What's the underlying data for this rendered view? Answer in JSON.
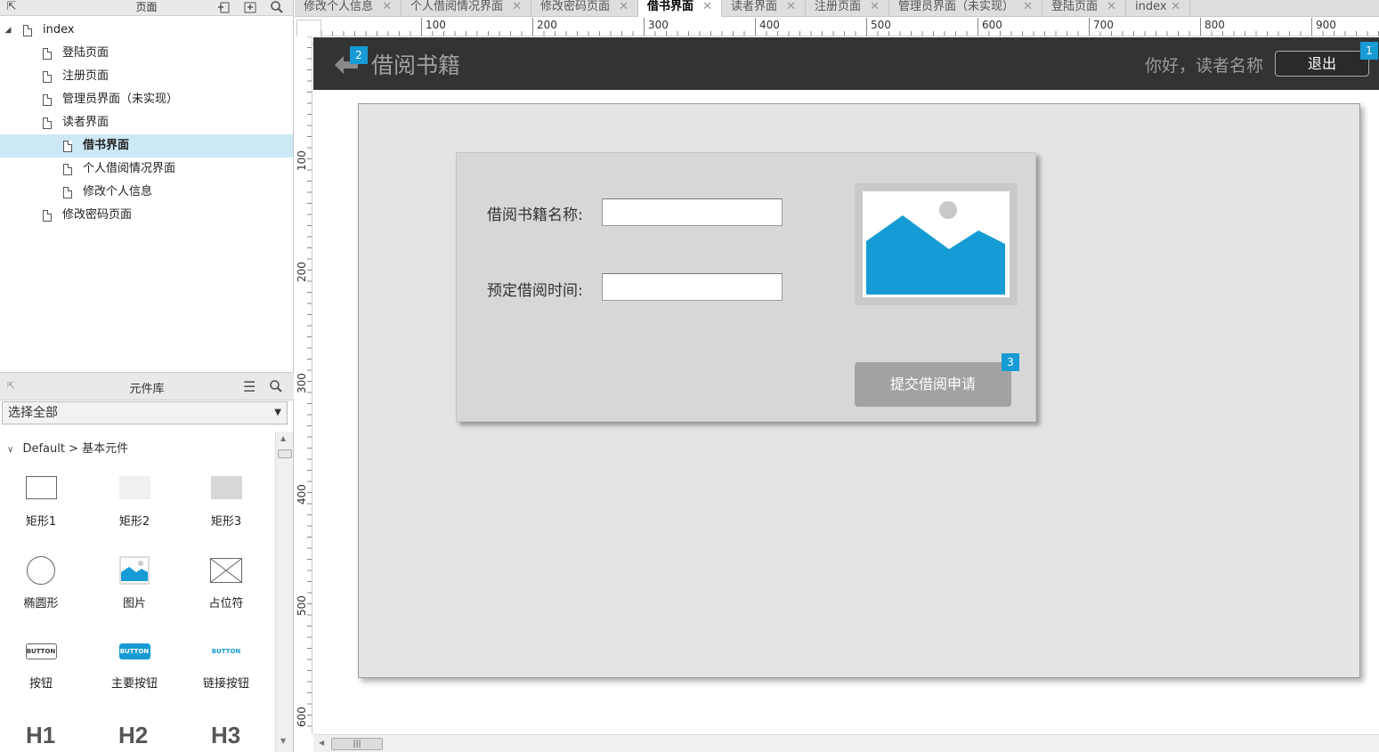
{
  "pages_panel": {
    "title": "页面",
    "tree": [
      {
        "label": "index",
        "level": 0,
        "expanded": true,
        "arrow": "◢"
      },
      {
        "label": "登陆页面",
        "level": 1
      },
      {
        "label": "注册页面",
        "level": 1
      },
      {
        "label": "管理员界面（未实现）",
        "level": 1,
        "arrow": "▷"
      },
      {
        "label": "读者界面",
        "level": 1,
        "expanded": true,
        "arrow": "◢"
      },
      {
        "label": "借书界面",
        "level": 2,
        "selected": true
      },
      {
        "label": "个人借阅情况界面",
        "level": 2
      },
      {
        "label": "修改个人信息",
        "level": 2
      },
      {
        "label": "修改密码页面",
        "level": 1
      }
    ]
  },
  "library_panel": {
    "title": "元件库",
    "select_value": "选择全部",
    "category": "Default > 基本元件",
    "widgets": [
      {
        "label": "矩形1",
        "icon": "rectangle-white-icon"
      },
      {
        "label": "矩形2",
        "icon": "rectangle-lightgray-icon"
      },
      {
        "label": "矩形3",
        "icon": "rectangle-gray-icon"
      },
      {
        "label": "椭圆形",
        "icon": "ellipse-icon"
      },
      {
        "label": "图片",
        "icon": "image-icon"
      },
      {
        "label": "占位符",
        "icon": "placeholder-icon"
      },
      {
        "label": "按钮",
        "icon": "button-icon",
        "mini": "BUTTON"
      },
      {
        "label": "主要按钮",
        "icon": "primary-button-icon",
        "mini": "BUTTON"
      },
      {
        "label": "链接按钮",
        "icon": "link-button-icon",
        "mini": "BUTTON"
      }
    ],
    "headings": [
      "H1",
      "H2",
      "H3"
    ]
  },
  "tabs": [
    {
      "label": "修改个人信息"
    },
    {
      "label": "个人借阅情况界面"
    },
    {
      "label": "修改密码页面"
    },
    {
      "label": "借书界面",
      "active": true
    },
    {
      "label": "读者界面"
    },
    {
      "label": "注册页面"
    },
    {
      "label": "管理员界面（未实现）"
    },
    {
      "label": "登陆页面"
    },
    {
      "label": "index"
    }
  ],
  "ruler": {
    "top_labels": [
      "100",
      "200",
      "300",
      "400",
      "500",
      "600",
      "700",
      "800",
      "900"
    ],
    "left_labels": [
      "100",
      "200",
      "300",
      "400",
      "500",
      "600"
    ]
  },
  "canvas": {
    "header": {
      "title": "借阅书籍",
      "greeting": "你好，读者名称",
      "logout_label": "退出",
      "badge_back": "2",
      "badge_logout": "1"
    },
    "form": {
      "book_name_label": "借阅书籍名称:",
      "book_name_value": "",
      "borrow_time_label": "预定借阅时间:",
      "borrow_time_value": "",
      "submit_label": "提交借阅申请",
      "badge_submit": "3"
    }
  },
  "colors": {
    "header_bg": "#333333",
    "badge": "#169bd5",
    "image_blue": "#169bd5",
    "selected_row": "#cde8f6"
  }
}
